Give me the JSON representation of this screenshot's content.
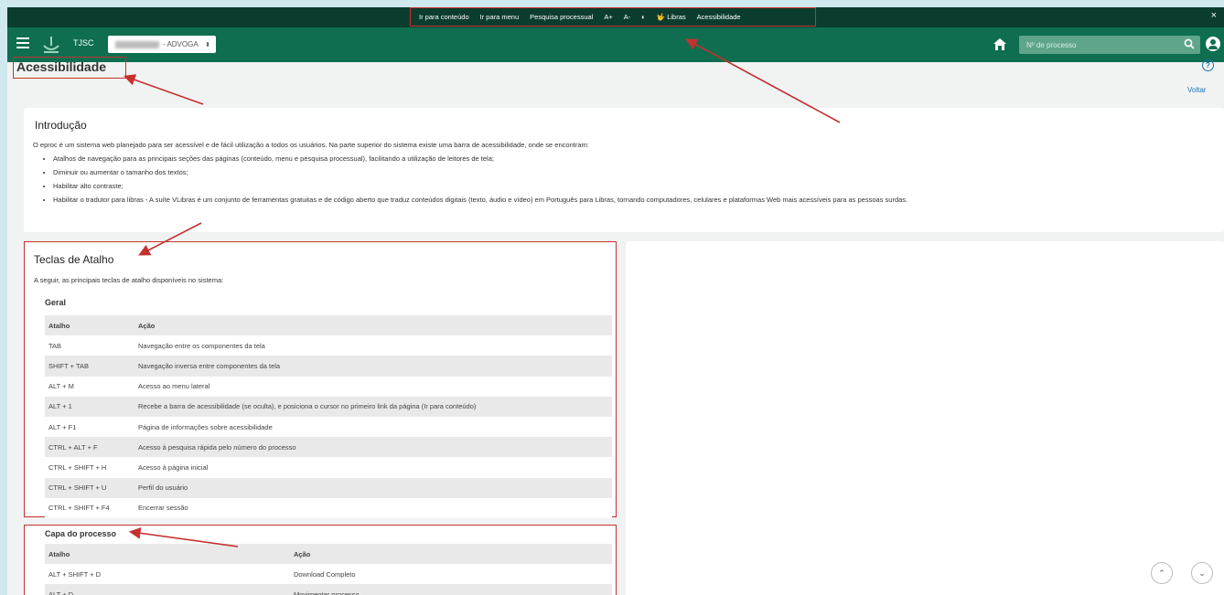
{
  "accessibility_bar": {
    "links": [
      "Ir para conteúdo",
      "Ir para menu",
      "Pesquisa processual",
      "A+",
      "A-",
      "◐",
      "🤟 Libras",
      "Acessibilidade"
    ],
    "close": "×"
  },
  "header": {
    "org": "TJSC",
    "profile_suffix": "- ADVOGA",
    "profile_caret": "⬍",
    "search_placeholder": "Nº de processo"
  },
  "page": {
    "title": "Acessibilidade",
    "help": "?",
    "back": "Voltar"
  },
  "intro": {
    "heading": "Introdução",
    "text": "O eproc é um sistema web planejado para ser acessível e de fácil utilização a todos os usuários. Na parte superior do sistema existe uma barra de acessibilidade, onde se encontram:",
    "items": [
      "Atalhos de navegação para as principais seções das páginas (conteúdo, menu e pesquisa processual), facilitando a utilização de leitores de tela;",
      "Diminuir ou aumentar o tamanho dos textos;",
      "Habilitar alto contraste;",
      "Habilitar o tradutor para libras - A suíte VLibras é um conjunto de ferramentas gratuitas e de código aberto que traduz conteúdos digitais (texto, áudio e vídeo) em Português para Libras, tornando computadores, celulares e plataformas Web mais acessíveis para as pessoas surdas."
    ]
  },
  "shortcuts": {
    "heading": "Teclas de Atalho",
    "subtitle": "A seguir, as principais teclas de atalho disponíveis no sistema:",
    "general": {
      "heading": "Geral",
      "columns": [
        "Atalho",
        "Ação"
      ],
      "rows": [
        [
          "TAB",
          "Navegação entre os componentes da tela"
        ],
        [
          "SHIFT + TAB",
          "Navegação inversa entre componentes da tela"
        ],
        [
          "ALT + M",
          "Acesso ao menu lateral"
        ],
        [
          "ALT + 1",
          "Recebe a barra de acessibilidade (se oculta), e posiciona o cursor no primeiro link da página (Ir para conteúdo)"
        ],
        [
          "ALT + F1",
          "Página de informações sobre acessibilidade"
        ],
        [
          "CTRL + ALT + F",
          "Acesso à pesquisa rápida pelo número do processo"
        ],
        [
          "CTRL + SHIFT + H",
          "Acesso à página inicial"
        ],
        [
          "CTRL + SHIFT + U",
          "Perfil do usuário"
        ],
        [
          "CTRL + SHIFT + F4",
          "Encerrar sessão"
        ]
      ]
    },
    "case_cover": {
      "heading": "Capa do processo",
      "columns": [
        "Atalho",
        "Ação"
      ],
      "rows": [
        [
          "ALT + SHIFT + D",
          "Download Completo"
        ],
        [
          "ALT + D",
          "Movimentar processo"
        ]
      ]
    }
  },
  "scroll": {
    "up": "⌃",
    "down": "⌄"
  },
  "colors": {
    "header": "#0e6e4f",
    "a11y_bar": "#0b3d2e",
    "annotation": "#c4312f"
  }
}
